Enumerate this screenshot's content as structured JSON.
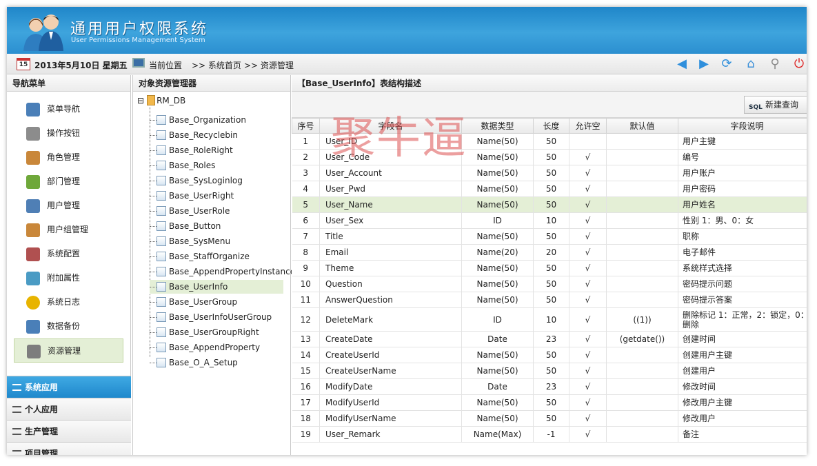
{
  "header": {
    "title": "通用用户权限系统",
    "subtitle": "User Permissions Management System"
  },
  "bar": {
    "calendar_day": "15",
    "date": "2013年5月10日 星期五",
    "position_label": "当前位置",
    "crumbs": [
      ">> 系统首页",
      ">> 资源管理"
    ],
    "icons": [
      "arrow-left-icon",
      "arrow-right-icon",
      "refresh-icon",
      "home-icon",
      "search-icon",
      "power-icon"
    ]
  },
  "nav": {
    "title": "导航菜单",
    "items": [
      {
        "label": "菜单导航",
        "icon": "sitemap-icon",
        "color": "#4a7fb8"
      },
      {
        "label": "操作按钮",
        "icon": "tools-icon",
        "color": "#8c8c8c"
      },
      {
        "label": "角色管理",
        "icon": "users-icon",
        "color": "#c9873a"
      },
      {
        "label": "部门管理",
        "icon": "branch-icon",
        "color": "#6fa83a"
      },
      {
        "label": "用户管理",
        "icon": "user-card-icon",
        "color": "#4f7fb5"
      },
      {
        "label": "用户组管理",
        "icon": "user-group-icon",
        "color": "#c9873a"
      },
      {
        "label": "系统配置",
        "icon": "wrench-icon",
        "color": "#b05050"
      },
      {
        "label": "附加属性",
        "icon": "attribute-icon",
        "color": "#4a9bc4"
      },
      {
        "label": "系统日志",
        "icon": "warning-icon",
        "color": "#e8b400"
      },
      {
        "label": "数据备份",
        "icon": "backup-icon",
        "color": "#4a7fb8"
      },
      {
        "label": "资源管理",
        "icon": "database-icon",
        "color": "#7d7d7d"
      }
    ],
    "accordion": [
      "系统应用",
      "个人应用",
      "生产管理",
      "项目管理"
    ]
  },
  "tree": {
    "title": "对象资源管理器",
    "root": "RM_DB",
    "nodes": [
      "Base_Organization",
      "Base_Recyclebin",
      "Base_RoleRight",
      "Base_Roles",
      "Base_SysLoginlog",
      "Base_UserRight",
      "Base_UserRole",
      "Base_Button",
      "Base_SysMenu",
      "Base_StaffOrganize",
      "Base_AppendPropertyInstance",
      "Base_UserInfo",
      "Base_UserGroup",
      "Base_UserInfoUserGroup",
      "Base_UserGroupRight",
      "Base_AppendProperty",
      "Base_O_A_Setup"
    ]
  },
  "main": {
    "title": "【Base_UserInfo】表结构描述",
    "new_query_label": "新建查询",
    "watermark": "聚牛逼",
    "columns": [
      "序号",
      "字段名",
      "数据类型",
      "长度",
      "允许空",
      "默认值",
      "字段说明"
    ],
    "rows": [
      [
        "1",
        "User_ID",
        "Name(50)",
        "50",
        "",
        "",
        "用户主键"
      ],
      [
        "2",
        "User_Code",
        "Name(50)",
        "50",
        "√",
        "",
        "编号"
      ],
      [
        "3",
        "User_Account",
        "Name(50)",
        "50",
        "√",
        "",
        "用户账户"
      ],
      [
        "4",
        "User_Pwd",
        "Name(50)",
        "50",
        "√",
        "",
        "用户密码"
      ],
      [
        "5",
        "User_Name",
        "Name(50)",
        "50",
        "√",
        "",
        "用户姓名"
      ],
      [
        "6",
        "User_Sex",
        "ID",
        "10",
        "√",
        "",
        "性别 1：男、0：女"
      ],
      [
        "7",
        "Title",
        "Name(50)",
        "50",
        "√",
        "",
        "职称"
      ],
      [
        "8",
        "Email",
        "Name(20)",
        "20",
        "√",
        "",
        "电子邮件"
      ],
      [
        "9",
        "Theme",
        "Name(50)",
        "50",
        "√",
        "",
        "系统样式选择"
      ],
      [
        "10",
        "Question",
        "Name(50)",
        "50",
        "√",
        "",
        "密码提示问题"
      ],
      [
        "11",
        "AnswerQuestion",
        "Name(50)",
        "50",
        "√",
        "",
        "密码提示答案"
      ],
      [
        "12",
        "DeleteMark",
        "ID",
        "10",
        "√",
        "((1))",
        "删除标记 1：正常，2：锁定，0：删除"
      ],
      [
        "13",
        "CreateDate",
        "Date",
        "23",
        "√",
        "(getdate())",
        "创建时间"
      ],
      [
        "14",
        "CreateUserId",
        "Name(50)",
        "50",
        "√",
        "",
        "创建用户主键"
      ],
      [
        "15",
        "CreateUserName",
        "Name(50)",
        "50",
        "√",
        "",
        "创建用户"
      ],
      [
        "16",
        "ModifyDate",
        "Date",
        "23",
        "√",
        "",
        "修改时间"
      ],
      [
        "17",
        "ModifyUserId",
        "Name(50)",
        "50",
        "√",
        "",
        "修改用户主键"
      ],
      [
        "18",
        "ModifyUserName",
        "Name(50)",
        "50",
        "√",
        "",
        "修改用户"
      ],
      [
        "19",
        "User_Remark",
        "Name(Max)",
        "-1",
        "√",
        "",
        "备注"
      ]
    ],
    "selected_row": 5
  }
}
